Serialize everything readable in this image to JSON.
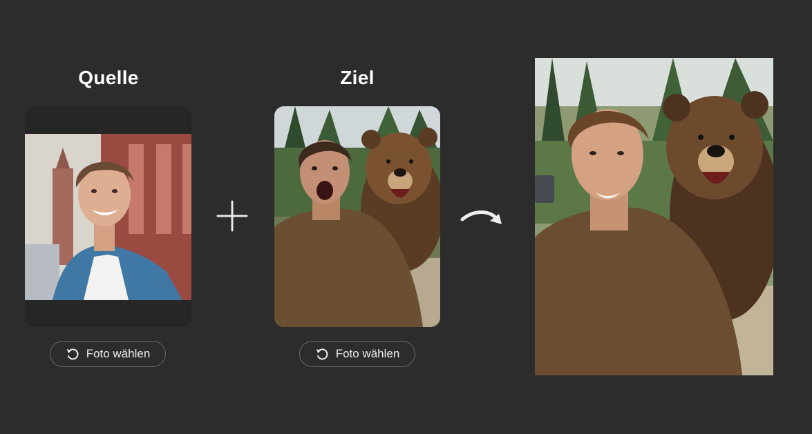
{
  "source": {
    "title": "Quelle",
    "button_label": "Foto wählen",
    "button_icon": "rotate-ccw-icon"
  },
  "target": {
    "title": "Ziel",
    "button_label": "Foto wählen",
    "button_icon": "rotate-ccw-icon"
  },
  "operator_icon": "plus-icon",
  "flow_icon": "curved-arrow-right-icon",
  "colors": {
    "background": "#2c2c2c",
    "text": "#ffffff",
    "button_border": "#6a6a6a"
  }
}
